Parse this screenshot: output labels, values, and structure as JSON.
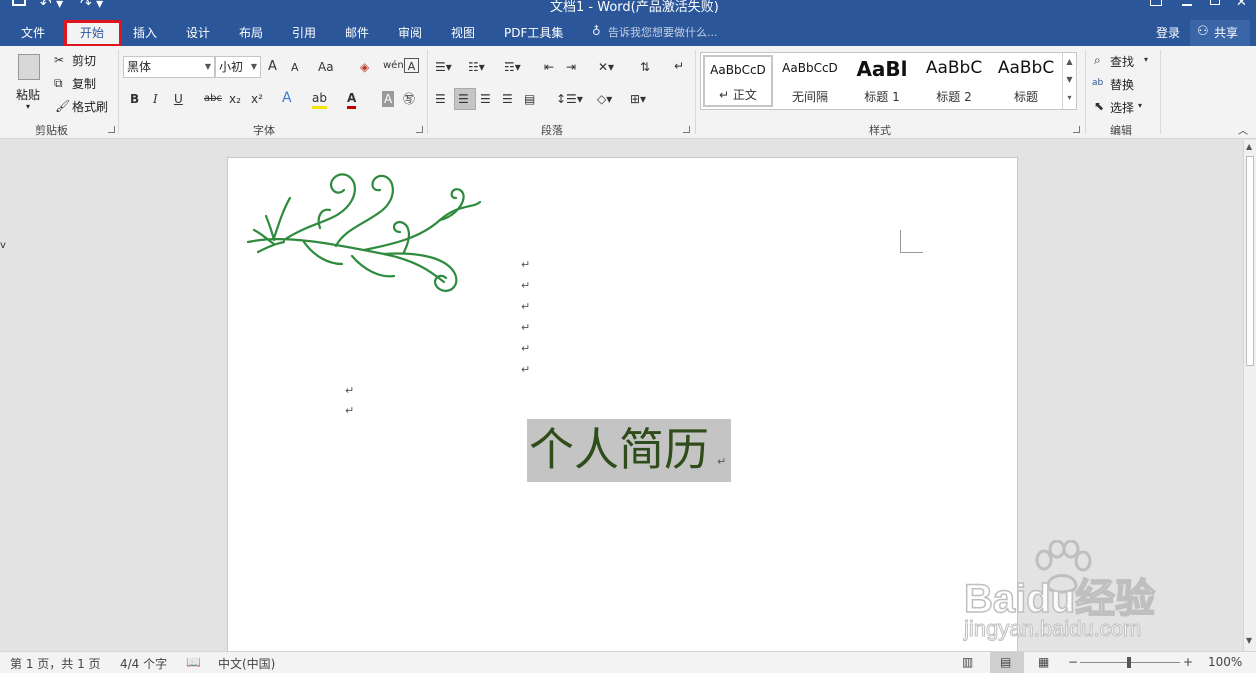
{
  "window": {
    "title": "文档1 - Word(产品激活失败)"
  },
  "tabs": [
    {
      "label": "文件"
    },
    {
      "label": "开始"
    },
    {
      "label": "插入"
    },
    {
      "label": "设计"
    },
    {
      "label": "布局"
    },
    {
      "label": "引用"
    },
    {
      "label": "邮件"
    },
    {
      "label": "审阅"
    },
    {
      "label": "视图"
    },
    {
      "label": "PDF工具集"
    }
  ],
  "tell_me": "告诉我您想要做什么...",
  "account": {
    "login": "登录",
    "share": "共享"
  },
  "clipboard": {
    "paste": "粘贴",
    "cut": "剪切",
    "copy": "复制",
    "format_painter": "格式刷",
    "label": "剪贴板"
  },
  "font": {
    "name": "黑体",
    "size": "小初",
    "grow": "A",
    "shrink": "A",
    "change_case": "Aa",
    "phonetic": "wén",
    "bold": "B",
    "italic": "I",
    "underline": "U",
    "strike": "abc",
    "subscript": "x₂",
    "superscript": "x²",
    "label": "字体"
  },
  "paragraph": {
    "label": "段落"
  },
  "styles": {
    "items": [
      {
        "sample": "AaBbCcD",
        "name": "正文"
      },
      {
        "sample": "AaBbCcD",
        "name": "无间隔"
      },
      {
        "sample": "AaBl",
        "name": "标题 1"
      },
      {
        "sample": "AaBbC",
        "name": "标题 2"
      },
      {
        "sample": "AaBbC",
        "name": "标题"
      }
    ],
    "label": "样式"
  },
  "editing": {
    "find": "查找",
    "replace": "替换",
    "select": "选择",
    "label": "编辑"
  },
  "document": {
    "heading": "个人简历",
    "paragraph_mark": "↵"
  },
  "status": {
    "page": "第 1 页，共 1 页",
    "words": "4/4 个字",
    "language": "中文(中国)",
    "zoom": "100%"
  },
  "watermark": {
    "brand": "Baidu经验",
    "url": "jingyan.baidu.com"
  },
  "colors": {
    "title_blue": "#2b579a",
    "highlight_red": "#e0161e",
    "heading_green": "#2e4d1a",
    "selection_gray": "#c4c4c4",
    "vine_green": "#2e8b3e"
  }
}
